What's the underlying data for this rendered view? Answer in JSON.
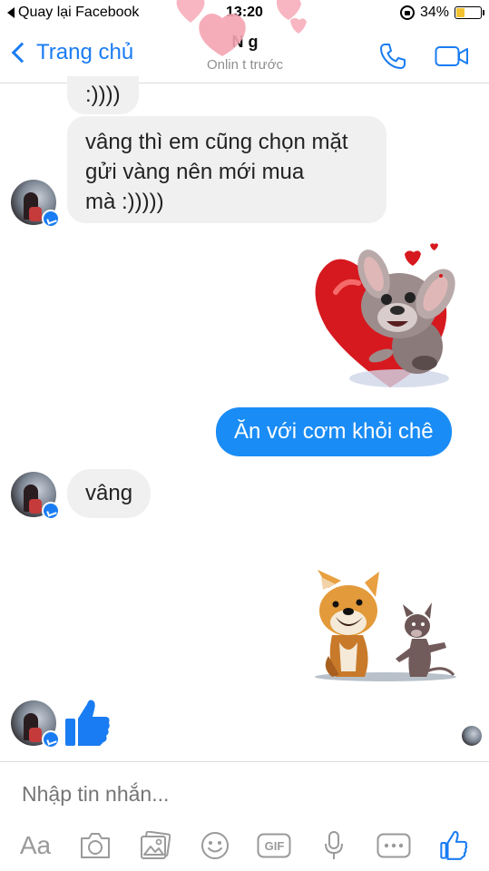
{
  "status_bar": {
    "back_app": "Quay lại Facebook",
    "time": "13:20",
    "battery_percent": "34%",
    "battery_level": 0.34
  },
  "nav": {
    "back_label": "Trang chủ",
    "contact_name": "N          g",
    "presence": "Onlin          t trước",
    "accent": "#1a7cf2"
  },
  "messages": {
    "m1": ":))))",
    "m2_line1": "vâng thì em cũng chọn mặt",
    "m2_line2": "gửi vàng nên mới mua",
    "m2_line3": "mà :)))))",
    "m3": "Ăn với cơm khỏi chê",
    "m4": "vâng"
  },
  "composer": {
    "placeholder": "Nhập tin nhắn...",
    "aa_label": "Aa",
    "gif_label": "GIF"
  },
  "icons": [
    "back-arrow-icon",
    "lock-rotation-icon",
    "battery-icon",
    "phone-icon",
    "video-call-icon",
    "heart-icon",
    "messenger-badge-icon",
    "like-thumb-icon",
    "camera-icon",
    "gallery-icon",
    "emoji-icon",
    "gif-icon",
    "microphone-icon",
    "more-icon"
  ],
  "colors": {
    "bubble_out": "#1a8cf5",
    "bubble_in": "#f0f0f0",
    "icon_gray": "#9a9a9a"
  }
}
